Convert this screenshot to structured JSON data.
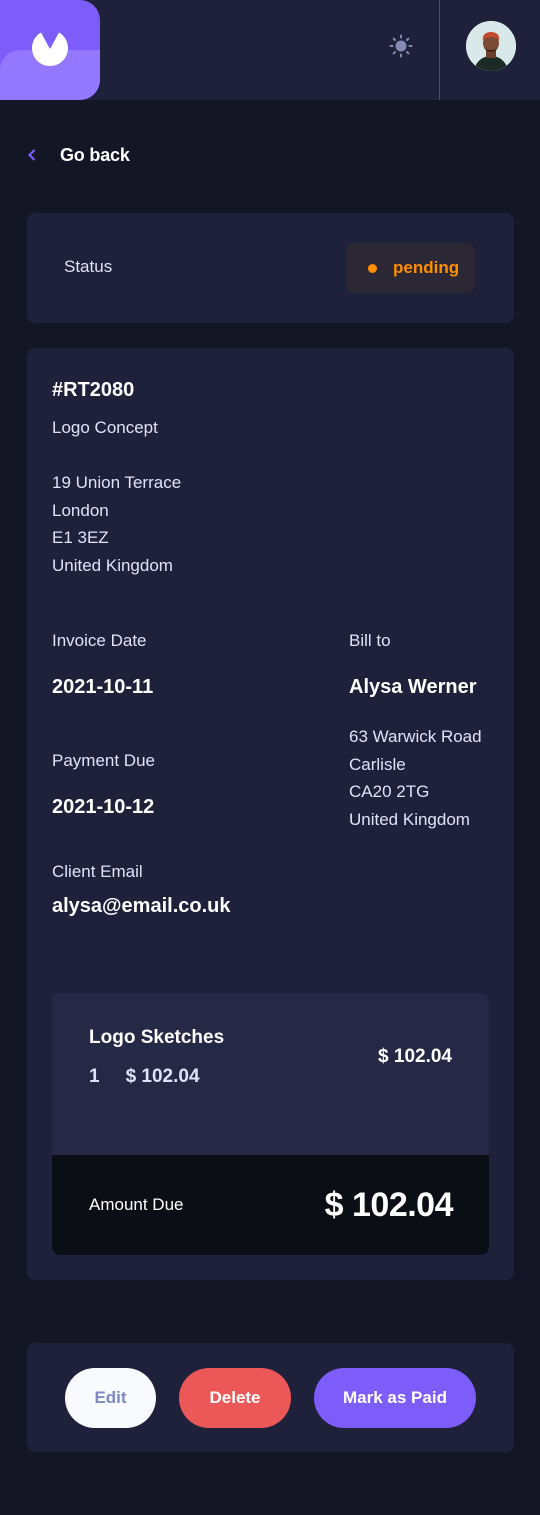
{
  "header": {
    "logo_icon": "app-logo-icon",
    "theme_toggle_icon": "sun-icon",
    "avatar": "user-avatar"
  },
  "nav": {
    "back_label": "Go back",
    "back_icon": "chevron-left-icon"
  },
  "status": {
    "label": "Status",
    "value": "pending",
    "color": "#ff8f00"
  },
  "invoice": {
    "id": "#RT2080",
    "description": "Logo Concept",
    "sender_address": [
      "19 Union Terrace",
      "London",
      "E1 3EZ",
      "United Kingdom"
    ],
    "invoice_date_label": "Invoice Date",
    "invoice_date": "2021-10-11",
    "payment_due_label": "Payment Due",
    "payment_due": "2021-10-12",
    "bill_to_label": "Bill to",
    "client_name": "Alysa Werner",
    "client_address": [
      "63 Warwick Road",
      "Carlisle",
      "CA20 2TG",
      "United Kingdom"
    ],
    "client_email_label": "Client Email",
    "client_email": "alysa@email.co.uk"
  },
  "items": [
    {
      "name": "Logo Sketches",
      "quantity": "1",
      "price": "$ 102.04",
      "total": "$ 102.04"
    }
  ],
  "amount_due": {
    "label": "Amount Due",
    "value": "$ 102.04"
  },
  "actions": {
    "edit_label": "Edit",
    "delete_label": "Delete",
    "mark_paid_label": "Mark as Paid"
  },
  "colors": {
    "accent": "#7c5dfa",
    "danger": "#ec5757",
    "background": "#141625",
    "card": "#1e2139"
  }
}
